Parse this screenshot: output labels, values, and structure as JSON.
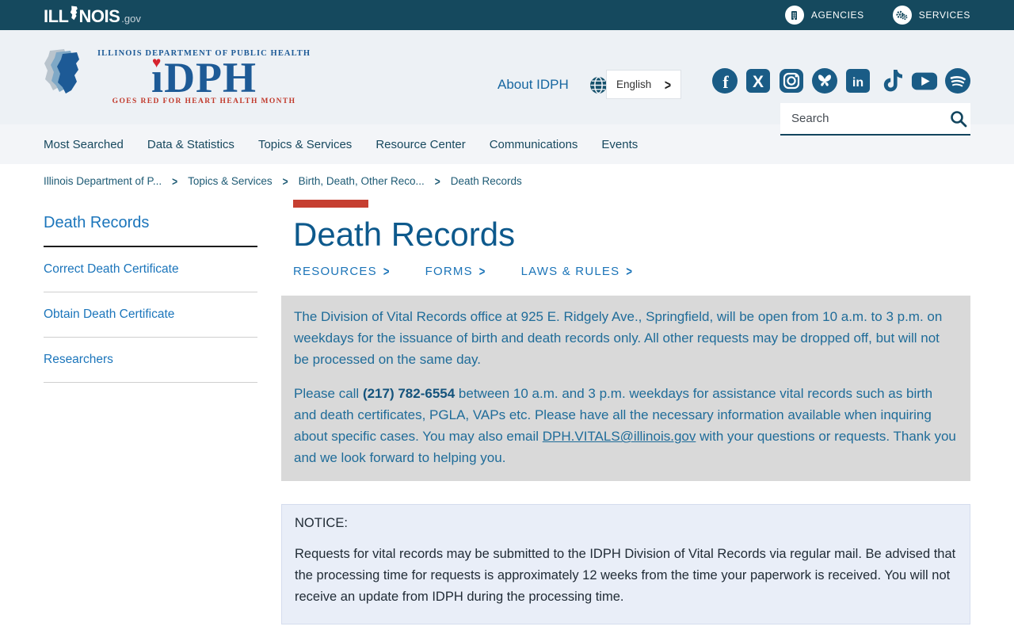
{
  "topbar": {
    "logo_part1": "ILL",
    "logo_part2": "NOIS",
    "logo_suffix": ".gov",
    "agencies_label": "AGENCIES",
    "services_label": "SERVICES"
  },
  "header": {
    "logo_top_text": "ILLINOIS DEPARTMENT OF PUBLIC HEALTH",
    "logo_main_text": "DPH",
    "logo_bottom_text": "GOES RED FOR HEART HEALTH MONTH",
    "about_link": "About IDPH",
    "language_selected": "English",
    "language_chevron": ">",
    "search_placeholder": "Search"
  },
  "social_icons": [
    "facebook",
    "x-twitter",
    "instagram",
    "bluesky",
    "linkedin",
    "tiktok",
    "youtube",
    "spotify"
  ],
  "nav": {
    "items": [
      "Most Searched",
      "Data & Statistics",
      "Topics & Services",
      "Resource Center",
      "Communications",
      "Events"
    ]
  },
  "breadcrumb": {
    "items": [
      "Illinois Department of P...",
      "Topics & Services",
      "Birth, Death, Other Reco...",
      "Death Records"
    ],
    "separator": ">"
  },
  "sidebar": {
    "title": "Death Records",
    "items": [
      "Correct Death Certificate",
      "Obtain Death Certificate",
      "Researchers"
    ]
  },
  "main": {
    "page_title": "Death Records",
    "quick_links": [
      "RESOURCES",
      "FORMS",
      "LAWS & RULES"
    ],
    "quick_link_chevron": ">",
    "info_box": {
      "paragraph1": "The Division of Vital Records office at 925 E. Ridgely Ave., Springfield, will be open from 10 a.m. to 3 p.m. on weekdays for the issuance of birth and death records only. All other requests may be dropped off, but will not be processed on the same day.",
      "paragraph2_before_phone": "Please call ",
      "phone": "(217) 782-6554",
      "paragraph2_middle": " between 10 a.m. and 3 p.m. weekdays for assistance vital records such as birth and death certificates, PGLA, VAPs etc. Please have all the necessary information available when inquiring about specific cases. You may also email ",
      "email": "DPH.VITALS@illinois.gov",
      "paragraph2_after_email": " with your questions or requests. Thank you and we look forward to helping you."
    },
    "notice_box": {
      "title": "NOTICE:",
      "body": "Requests for vital records may be submitted to the IDPH Division of Vital Records via regular mail. Be advised that the processing time for requests is approximately 12 weeks from the time your paperwork is received. You will not receive an update from IDPH during the processing time."
    }
  },
  "colors": {
    "topbar_bg": "#15495e",
    "header_bg": "#edf1f5",
    "nav_bg": "#f3f5f8",
    "link_blue": "#1b75bb",
    "heading_blue": "#0d598c",
    "accent_red": "#c63f31",
    "info_box_bg": "#d9d9d9",
    "info_text_blue": "#1f6c99",
    "notice_bg": "#e9eef8",
    "social_icon_blue": "#1a5c86"
  }
}
